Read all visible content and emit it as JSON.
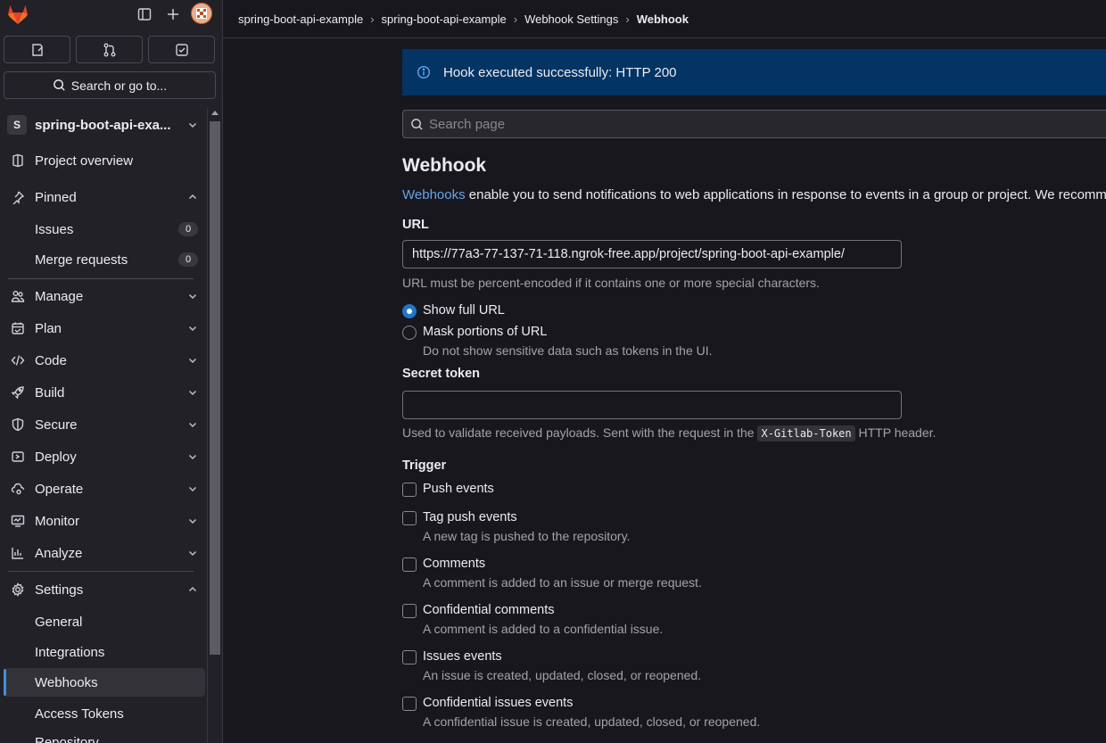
{
  "sidebar": {
    "quick_actions": [
      "issues-icon",
      "merge-request-icon",
      "todo-icon"
    ],
    "search_label": "Search or go to...",
    "project": {
      "initial": "S",
      "name": "spring-boot-api-exa..."
    },
    "project_overview": "Project overview",
    "pinned": "Pinned",
    "issues": "Issues",
    "issues_count": "0",
    "merge_requests": "Merge requests",
    "mr_count": "0",
    "manage": "Manage",
    "plan": "Plan",
    "code": "Code",
    "build": "Build",
    "secure": "Secure",
    "deploy": "Deploy",
    "operate": "Operate",
    "monitor": "Monitor",
    "analyze": "Analyze",
    "settings": "Settings",
    "general": "General",
    "integrations": "Integrations",
    "webhooks": "Webhooks",
    "access_tokens": "Access Tokens",
    "repository": "Repository"
  },
  "breadcrumb": {
    "c1": "spring-boot-api-example",
    "c2": "spring-boot-api-example",
    "c3": "Webhook Settings",
    "c4": "Webhook"
  },
  "alert": {
    "text": "Hook executed successfully: HTTP 200"
  },
  "search": {
    "placeholder": "Search page"
  },
  "page": {
    "title": "Webhook",
    "desc_link": "Webhooks",
    "desc_rest": " enable you to send notifications to web applications in response to events in a group or project. We recomm",
    "url_label": "URL",
    "url_value": "https://77a3-77-137-71-118.ngrok-free.app/project/spring-boot-api-example/",
    "url_help": "URL must be percent-encoded if it contains one or more special characters.",
    "show_full_url": "Show full URL",
    "mask_url": "Mask portions of URL",
    "mask_help": "Do not show sensitive data such as tokens in the UI.",
    "secret_label": "Secret token",
    "secret_help_pre": "Used to validate received payloads. Sent with the request in the ",
    "secret_help_code": "X-Gitlab-Token",
    "secret_help_post": " HTTP header.",
    "trigger_label": "Trigger",
    "push_events": "Push events",
    "tag_push": "Tag push events",
    "tag_push_help": "A new tag is pushed to the repository.",
    "comments": "Comments",
    "comments_help": "A comment is added to an issue or merge request.",
    "conf_comments": "Confidential comments",
    "conf_comments_help": "A comment is added to a confidential issue.",
    "issues_events": "Issues events",
    "issues_events_help": "An issue is created, updated, closed, or reopened.",
    "conf_issues": "Confidential issues events",
    "conf_issues_help": "A confidential issue is created, updated, closed, or reopened."
  },
  "colors": {
    "accent": "#428fdc",
    "alert_bg": "#033464",
    "brand": "#e24329"
  }
}
